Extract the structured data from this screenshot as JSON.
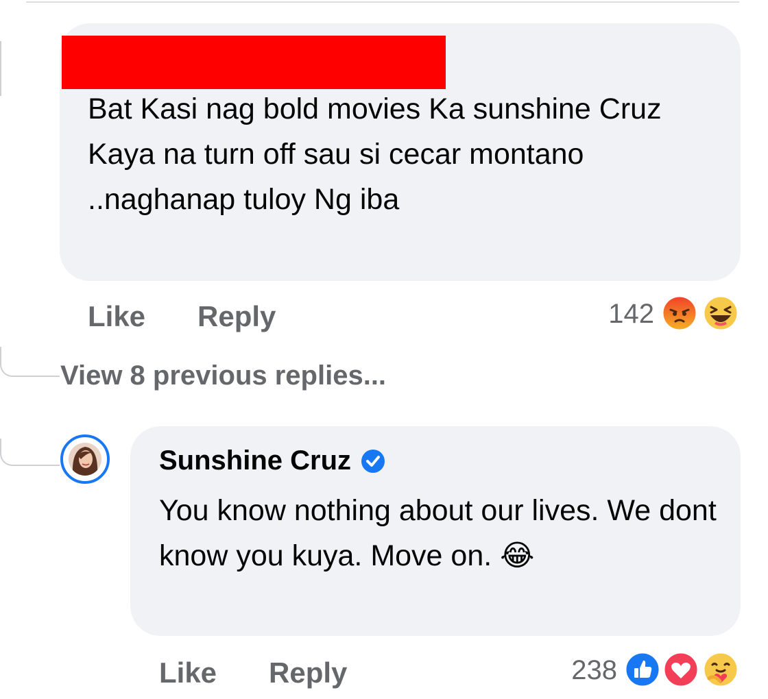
{
  "comment_1": {
    "author": "",
    "text": "Bat Kasi nag bold movies Ka sunshine Cruz Kaya na turn off sau si cecar montano ..naghanap tuloy Ng iba",
    "like_label": "Like",
    "reply_label": "Reply",
    "reaction_count": "142",
    "reactions": [
      "angry",
      "haha"
    ]
  },
  "view_previous_replies": "View 8 previous replies...",
  "reply": {
    "author": "Sunshine Cruz",
    "verified": true,
    "text": "You know nothing about our lives. We dont know you kuya. Move on. 😂",
    "like_label": "Like",
    "reply_label": "Reply",
    "reaction_count": "238",
    "reactions": [
      "like",
      "love",
      "care"
    ]
  },
  "colors": {
    "bubble": "#f0f2f5",
    "secondary_text": "#65676b",
    "verified_blue": "#1877f2",
    "redaction": "#ff0000"
  }
}
